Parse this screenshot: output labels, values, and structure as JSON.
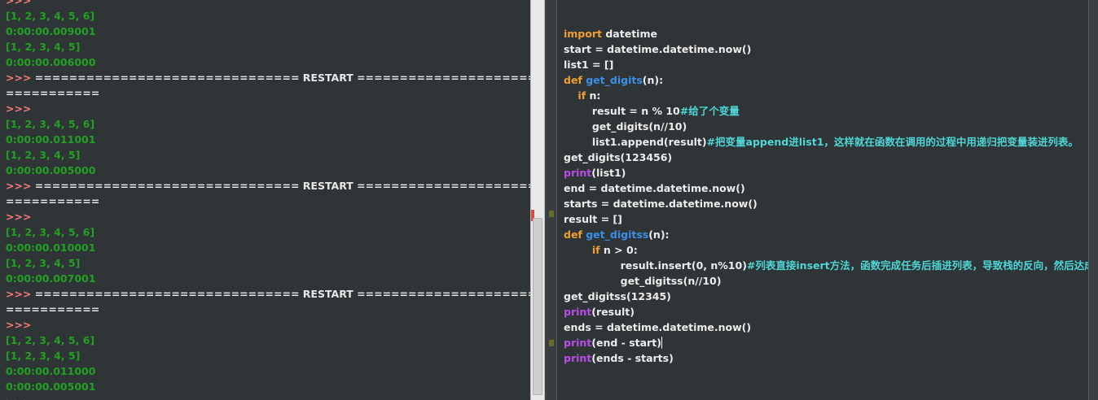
{
  "shell": {
    "lines": [
      {
        "type": "prompt",
        "text": ">>>"
      },
      {
        "type": "out",
        "text": "[1, 2, 3, 4, 5, 6]"
      },
      {
        "type": "out",
        "text": "0:00:00.009001"
      },
      {
        "type": "out",
        "text": "[1, 2, 3, 4, 5]"
      },
      {
        "type": "out",
        "text": "0:00:00.006000"
      },
      {
        "type": "restart",
        "prompt": ">>>",
        "text": " =============================== RESTART ====================="
      },
      {
        "type": "restart-cont",
        "text": "==========="
      },
      {
        "type": "prompt",
        "text": ">>>"
      },
      {
        "type": "out",
        "text": "[1, 2, 3, 4, 5, 6]"
      },
      {
        "type": "out",
        "text": "0:00:00.011001"
      },
      {
        "type": "out",
        "text": "[1, 2, 3, 4, 5]"
      },
      {
        "type": "out",
        "text": "0:00:00.005000"
      },
      {
        "type": "restart",
        "prompt": ">>>",
        "text": " =============================== RESTART ====================="
      },
      {
        "type": "restart-cont",
        "text": "==========="
      },
      {
        "type": "prompt",
        "text": ">>>"
      },
      {
        "type": "out",
        "text": "[1, 2, 3, 4, 5, 6]"
      },
      {
        "type": "out",
        "text": "0:00:00.010001"
      },
      {
        "type": "out",
        "text": "[1, 2, 3, 4, 5]"
      },
      {
        "type": "out",
        "text": "0:00:00.007001"
      },
      {
        "type": "restart",
        "prompt": ">>>",
        "text": " =============================== RESTART ====================="
      },
      {
        "type": "restart-cont",
        "text": "==========="
      },
      {
        "type": "prompt",
        "text": ">>>"
      },
      {
        "type": "out",
        "text": "[1, 2, 3, 4, 5, 6]"
      },
      {
        "type": "out",
        "text": "[1, 2, 3, 4, 5]"
      },
      {
        "type": "out",
        "text": "0:00:00.011000"
      },
      {
        "type": "out",
        "text": "0:00:00.005001"
      },
      {
        "type": "prompt",
        "text": ">>>"
      }
    ]
  },
  "editor": {
    "lines": [
      [
        {
          "c": "kw",
          "t": "import"
        },
        {
          "c": "",
          "t": " datetime"
        }
      ],
      [
        {
          "c": "",
          "t": "start = datetime.datetime.now()"
        }
      ],
      [
        {
          "c": "",
          "t": "list1 = []"
        }
      ],
      [
        {
          "c": "kw",
          "t": "def"
        },
        {
          "c": "",
          "t": " "
        },
        {
          "c": "fn",
          "t": "get_digits"
        },
        {
          "c": "",
          "t": "(n):"
        }
      ],
      [
        {
          "c": "",
          "t": "    "
        },
        {
          "c": "kw",
          "t": "if"
        },
        {
          "c": "",
          "t": " n:"
        }
      ],
      [
        {
          "c": "",
          "t": "        result = n % 10"
        },
        {
          "c": "cm",
          "t": "#给了个变量"
        }
      ],
      [
        {
          "c": "",
          "t": "        get_digits(n//10)"
        }
      ],
      [
        {
          "c": "",
          "t": "        list1.append(result)"
        },
        {
          "c": "cm",
          "t": "#把变量append进list1，这样就在函数在调用的过程中用递归把变量装进列表。"
        }
      ],
      [
        {
          "c": "",
          "t": "get_digits(123456)"
        }
      ],
      [
        {
          "c": "bi",
          "t": "print"
        },
        {
          "c": "",
          "t": "(list1)"
        }
      ],
      [
        {
          "c": "",
          "t": "end = datetime.datetime.now()"
        }
      ],
      [
        {
          "c": "",
          "t": "starts = datetime.datetime.now()"
        }
      ],
      [
        {
          "c": "",
          "t": "result = []"
        }
      ],
      [
        {
          "c": "kw",
          "t": "def"
        },
        {
          "c": "",
          "t": " "
        },
        {
          "c": "fn",
          "t": "get_digitss"
        },
        {
          "c": "",
          "t": "(n):"
        }
      ],
      [
        {
          "c": "",
          "t": "        "
        },
        {
          "c": "kw",
          "t": "if"
        },
        {
          "c": "",
          "t": " n > 0:"
        }
      ],
      [
        {
          "c": "",
          "t": "                result.insert(0, n%10)"
        },
        {
          "c": "cm",
          "t": "#列表直接insert方法，函数完成任务后插进列表，导致栈的反向，然后达成"
        }
      ],
      [
        {
          "c": "",
          "t": "                get_digitss(n//10)"
        }
      ],
      [
        {
          "c": "",
          "t": "get_digitss(12345)"
        }
      ],
      [
        {
          "c": "bi",
          "t": "print"
        },
        {
          "c": "",
          "t": "(result)"
        }
      ],
      [
        {
          "c": "",
          "t": "ends = datetime.datetime.now()"
        }
      ],
      [
        {
          "c": "bi",
          "t": "print"
        },
        {
          "c": "",
          "t": "(end - start)"
        },
        {
          "c": "caret",
          "t": ""
        }
      ],
      [
        {
          "c": "bi",
          "t": "print"
        },
        {
          "c": "",
          "t": "(ends - starts)"
        }
      ]
    ]
  },
  "colors": {
    "output_green": "#22a022",
    "prompt_red": "#ff7a7a",
    "keyword_orange": "#f0a030",
    "function_blue": "#3b8fe8",
    "builtin_purple": "#b84ce6",
    "comment_cyan": "#4fd6d6",
    "background": "#2f3437"
  }
}
